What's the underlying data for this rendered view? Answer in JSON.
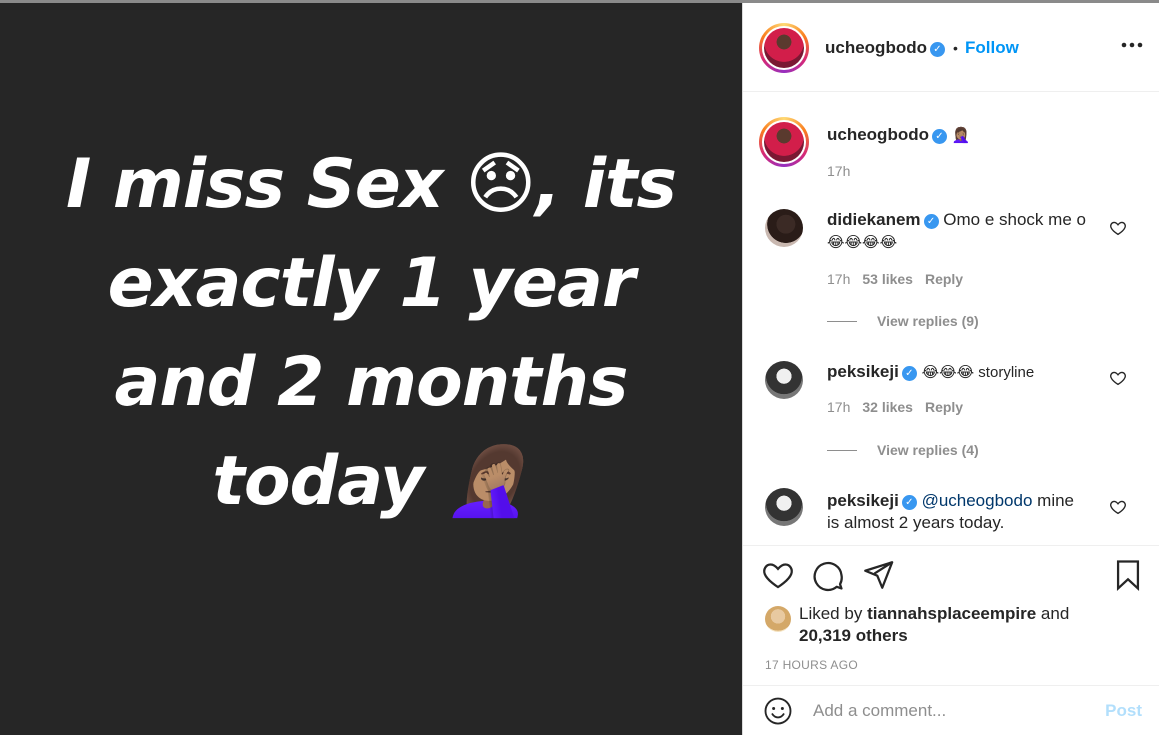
{
  "media": {
    "lines": [
      "I miss Sex 😞, its",
      "exactly 1 year",
      "and 2 months",
      "today 🤦🏽‍♀️"
    ]
  },
  "header": {
    "username": "ucheogbodo",
    "separator": "•",
    "follow_label": "Follow",
    "more_label": "..."
  },
  "caption": {
    "username": "ucheogbodo",
    "text": "🤦🏽‍♀️",
    "time": "17h"
  },
  "comments": [
    {
      "username": "didiekanem",
      "text": "Omo e shock me o",
      "text2": "😂😂😂😂",
      "time": "17h",
      "likes": "53 likes",
      "reply": "Reply",
      "view_replies": "View replies (9)"
    },
    {
      "username": "peksikeji",
      "text": "😂😂😂 storyline",
      "time": "17h",
      "likes": "32 likes",
      "reply": "Reply",
      "view_replies": "View replies (4)"
    },
    {
      "username": "peksikeji",
      "mention": "@ucheogbodo",
      "text": "mine",
      "text2": "is almost 2 years today."
    }
  ],
  "likes": {
    "prefix": "Liked by",
    "user": "tiannahsplaceempire",
    "suffix": "and",
    "others": "20,319 others"
  },
  "time_ago": "17 HOURS AGO",
  "add_comment": {
    "placeholder": "Add a comment...",
    "post_label": "Post"
  },
  "colors": {
    "accent": "#0095f6",
    "verified": "#3897f0",
    "media_bg": "#262626",
    "post_disabled": "#b2dffc"
  }
}
